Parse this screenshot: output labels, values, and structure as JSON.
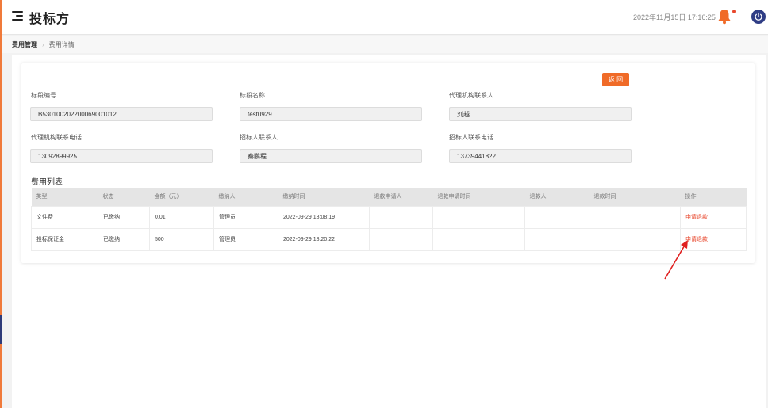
{
  "header": {
    "title": "投标方",
    "datetime": "2022年11月15日 17:16:25"
  },
  "breadcrumb": {
    "root": "费用管理",
    "current": "费用详情"
  },
  "actions": {
    "back_label": "返 回"
  },
  "fields": {
    "section_no": {
      "label": "标段编号",
      "value": "B530100202200069001012"
    },
    "section_name": {
      "label": "标段名称",
      "value": "test0929"
    },
    "agency_contact": {
      "label": "代理机构联系人",
      "value": "刘越"
    },
    "agency_phone": {
      "label": "代理机构联系电话",
      "value": "13092899925"
    },
    "tenderer_contact": {
      "label": "招标人联系人",
      "value": "秦鹏程"
    },
    "tenderer_phone": {
      "label": "招标人联系电话",
      "value": "13739441822"
    }
  },
  "fee_list": {
    "title": "费用列表",
    "columns": [
      "类型",
      "状态",
      "金额（元）",
      "缴纳人",
      "缴纳时间",
      "退款申请人",
      "退款申请时间",
      "退款人",
      "退款时间",
      "操作"
    ],
    "rows": [
      {
        "type": "文件费",
        "status": "已缴纳",
        "amount": "0.01",
        "payer": "管理员",
        "pay_time": "2022-09-29 18:08:19",
        "refund_applicant": "",
        "refund_apply_time": "",
        "refunder": "",
        "refund_time": "",
        "action": "申请退款"
      },
      {
        "type": "投标保证金",
        "status": "已缴纳",
        "amount": "500",
        "payer": "管理员",
        "pay_time": "2022-09-29 18:20:22",
        "refund_applicant": "",
        "refund_apply_time": "",
        "refunder": "",
        "refund_time": "",
        "action": "申请退款"
      }
    ]
  },
  "colors": {
    "accent": "#f06b28",
    "link": "#e8472c",
    "nav_dark": "#2f3d85",
    "annotation_arrow": "#e02020"
  },
  "icons": {
    "menu": "menu-icon",
    "notification": "bell-icon",
    "logout": "power-icon"
  }
}
